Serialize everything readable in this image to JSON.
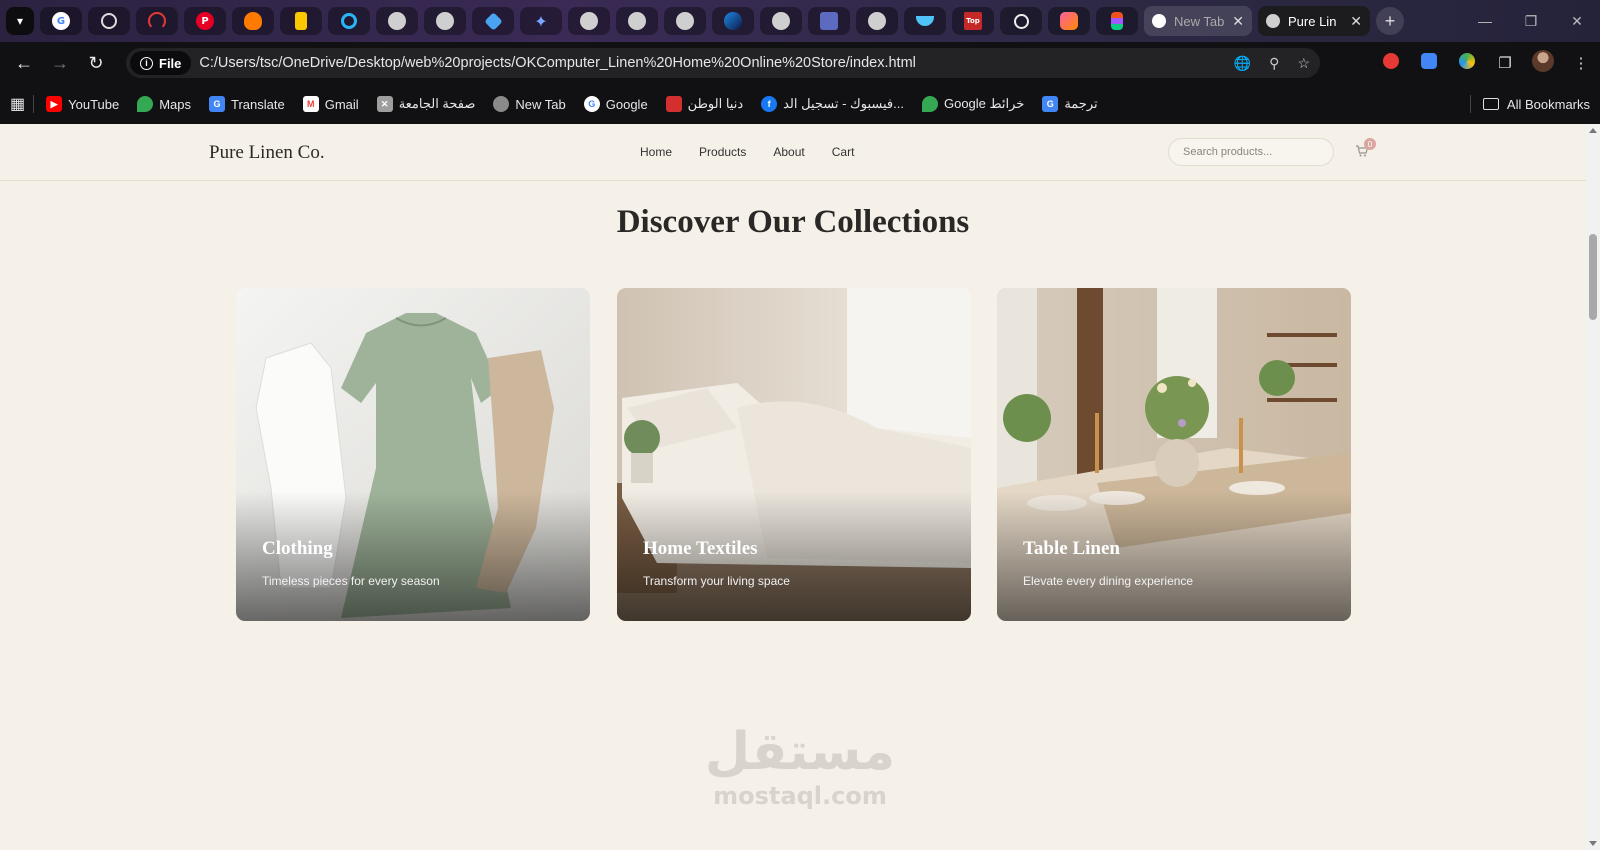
{
  "browser": {
    "tabs": [
      {
        "title": "New Tab",
        "active": false
      },
      {
        "title": "Pure Lin",
        "active": true
      }
    ],
    "address": {
      "scheme_chip": "File",
      "url": "C:/Users/tsc/OneDrive/Desktop/web%20projects/OKComputer_Linen%20Home%20Online%20Store/index.html"
    },
    "bookmarks": [
      {
        "label": "YouTube",
        "icon": "youtube-icon",
        "color": "#ff0000"
      },
      {
        "label": "Maps",
        "icon": "maps-icon",
        "color": "#34a853"
      },
      {
        "label": "Translate",
        "icon": "translate-icon",
        "color": "#4285f4"
      },
      {
        "label": "Gmail",
        "icon": "gmail-icon",
        "color": "#ea4335"
      },
      {
        "label": "صفحة الجامعة",
        "icon": "university-icon",
        "color": "#9e9e9e"
      },
      {
        "label": "New Tab",
        "icon": "globe-icon",
        "color": "#8a8a8a"
      },
      {
        "label": "Google",
        "icon": "google-icon",
        "color": "#4285f4"
      },
      {
        "label": "دنيا الوطن",
        "icon": "news-icon",
        "color": "#d32f2f"
      },
      {
        "label": "فيسبوك - تسجيل الد...",
        "icon": "facebook-icon",
        "color": "#1877f2"
      },
      {
        "label": "Google خرائط",
        "icon": "maps-icon",
        "color": "#34a853"
      },
      {
        "label": "ترجمة",
        "icon": "translate-icon",
        "color": "#4285f4"
      }
    ],
    "all_bookmarks": "All Bookmarks"
  },
  "site": {
    "logo": "Pure Linen Co.",
    "nav": [
      "Home",
      "Products",
      "About",
      "Cart"
    ],
    "search_placeholder": "Search products...",
    "cart_count": "0"
  },
  "main": {
    "title": "Discover Our Collections",
    "collections": [
      {
        "name": "Clothing",
        "tagline": "Timeless pieces for every season"
      },
      {
        "name": "Home Textiles",
        "tagline": "Transform your living space"
      },
      {
        "name": "Table Linen",
        "tagline": "Elevate every dining experience"
      }
    ]
  },
  "watermark": {
    "arabic": "مستقل",
    "latin": "mostaql.com"
  }
}
